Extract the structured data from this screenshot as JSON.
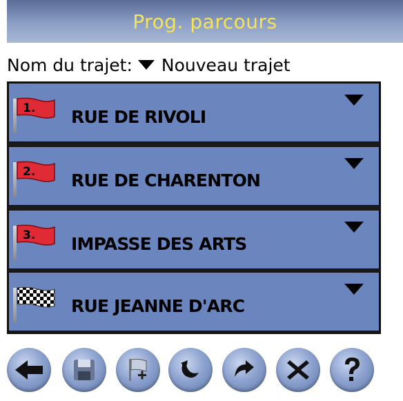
{
  "title": "Prog. parcours",
  "route": {
    "label": "Nom du trajet:",
    "value": "Nouveau trajet"
  },
  "items": [
    {
      "badge": "1.",
      "street": "RUE DE RIVOLI",
      "flag": "red-flag-icon"
    },
    {
      "badge": "2.",
      "street": "RUE DE CHARENTON",
      "flag": "red-flag-icon"
    },
    {
      "badge": "3.",
      "street": "IMPASSE DES ARTS",
      "flag": "red-flag-icon"
    },
    {
      "badge": "",
      "street": "RUE JEANNE D'ARC",
      "flag": "checkered-flag-icon"
    }
  ],
  "toolbar": [
    {
      "icon": "back-arrow-icon"
    },
    {
      "icon": "save-disk-icon"
    },
    {
      "icon": "add-waypoint-icon"
    },
    {
      "icon": "undo-icon"
    },
    {
      "icon": "redo-icon"
    },
    {
      "icon": "close-x-icon"
    },
    {
      "icon": "help-question-icon"
    }
  ],
  "colors": {
    "title_text": "#f6e35a",
    "list_item_bg": "#6b86bf",
    "flag_red": "#e02a35"
  }
}
